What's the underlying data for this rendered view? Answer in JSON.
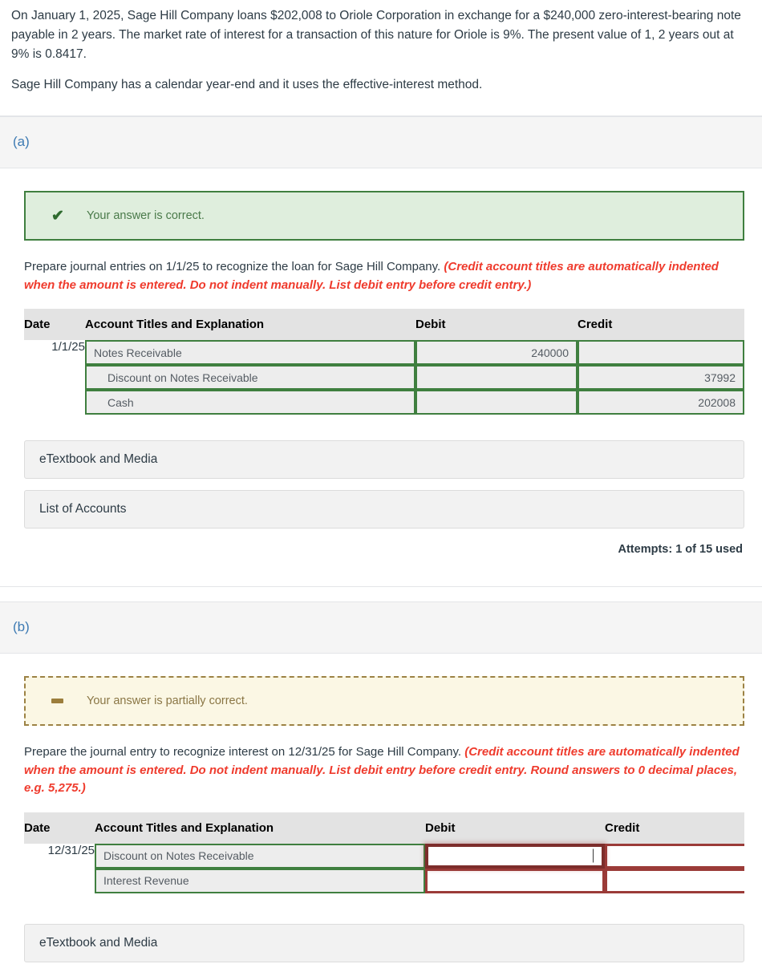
{
  "problem": {
    "paragraph1": "On January 1, 2025, Sage Hill Company loans $202,008 to Oriole Corporation in exchange for a $240,000 zero-interest-bearing note payable in 2 years. The market rate of interest for a transaction of this nature for Oriole is 9%. The present value of 1, 2 years out at 9% is 0.8417.",
    "paragraph2": "Sage Hill Company has a calendar year-end and it uses the effective-interest method."
  },
  "colors": {
    "link_blue": "#3d7ab3",
    "correct_green": "#3f7f3f",
    "incorrect_red": "#9b3b38",
    "note_red": "#ef3b2d",
    "partial_brown": "#9c8244"
  },
  "parts": [
    {
      "label": "(a)",
      "alert": {
        "status": "correct",
        "icon": "check-icon",
        "text": "Your answer is correct."
      },
      "instruction": {
        "lead": "Prepare journal entries on 1/1/25 to recognize the loan for Sage Hill Company.",
        "note": "(Credit account titles are automatically indented when the amount is entered. Do not indent manually. List debit entry before credit entry.)"
      },
      "table": {
        "headers": [
          "Date",
          "Account Titles and Explanation",
          "Debit",
          "Credit"
        ],
        "rows": [
          {
            "date": "1/1/25",
            "account": {
              "value": "Notes Receivable",
              "indented": false,
              "state": "ok"
            },
            "debit": {
              "value": "240000",
              "state": "ok",
              "focused": false
            },
            "credit": {
              "value": "",
              "state": "ok",
              "focused": false
            }
          },
          {
            "date": "",
            "account": {
              "value": "Discount on Notes Receivable",
              "indented": true,
              "state": "ok"
            },
            "debit": {
              "value": "",
              "state": "ok",
              "focused": false
            },
            "credit": {
              "value": "37992",
              "state": "ok",
              "focused": false
            }
          },
          {
            "date": "",
            "account": {
              "value": "Cash",
              "indented": true,
              "state": "ok"
            },
            "debit": {
              "value": "",
              "state": "ok",
              "focused": false
            },
            "credit": {
              "value": "202008",
              "state": "ok",
              "focused": false
            }
          }
        ]
      },
      "buttons": [
        "eTextbook and Media",
        "List of Accounts"
      ],
      "attempts": "Attempts: 1 of 15 used"
    },
    {
      "label": "(b)",
      "alert": {
        "status": "partial",
        "icon": "dash-icon",
        "text": "Your answer is partially correct."
      },
      "instruction": {
        "lead": "Prepare the journal entry to recognize interest on 12/31/25 for Sage Hill Company.",
        "note": "(Credit account titles are automatically indented when the amount is entered. Do not indent manually. List debit entry before credit entry. Round answers to 0 decimal places, e.g. 5,275.)"
      },
      "table": {
        "headers": [
          "Date",
          "Account Titles and Explanation",
          "Debit",
          "Credit"
        ],
        "rows": [
          {
            "date": "12/31/25",
            "account": {
              "value": "Discount on Notes Receivable",
              "indented": false,
              "state": "ok"
            },
            "debit": {
              "value": "",
              "state": "bad",
              "focused": true
            },
            "credit": {
              "value": "",
              "state": "bad",
              "focused": false
            }
          },
          {
            "date": "",
            "account": {
              "value": "Interest Revenue",
              "indented": false,
              "state": "ok"
            },
            "debit": {
              "value": "",
              "state": "bad",
              "focused": false
            },
            "credit": {
              "value": "",
              "state": "bad",
              "focused": false
            }
          }
        ]
      },
      "buttons": [
        "eTextbook and Media"
      ],
      "attempts": ""
    }
  ]
}
